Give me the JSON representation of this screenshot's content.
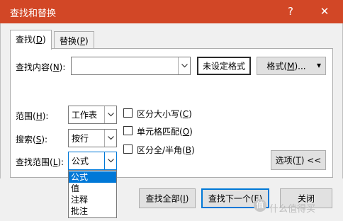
{
  "window": {
    "title": "查找和替换",
    "help_glyph": "?",
    "close_glyph": "✕"
  },
  "tabs": [
    {
      "text": "查找(",
      "key": "D",
      "tail": ")"
    },
    {
      "text": "替换(",
      "key": "P",
      "tail": ")"
    }
  ],
  "find": {
    "label_text": "查找内容(",
    "label_key": "N",
    "label_tail": "):",
    "value": "",
    "no_format_label": "未设定格式",
    "format_btn_text": "格式(",
    "format_btn_key": "M",
    "format_btn_tail": ")...",
    "format_arrow": "▾"
  },
  "scope": {
    "label_text": "范围(",
    "label_key": "H",
    "label_tail": "):",
    "value": "工作表"
  },
  "search": {
    "label_text": "搜索(",
    "label_key": "S",
    "label_tail": "):",
    "value": "按行"
  },
  "lookin": {
    "label_text": "查找范围(",
    "label_key": "L",
    "label_tail": "):",
    "value": "公式",
    "options": [
      "公式",
      "值",
      "注释",
      "批注"
    ],
    "selected_index": 0
  },
  "checkboxes": [
    {
      "text": "区分大小写(",
      "key": "C",
      "tail": ")",
      "checked": false
    },
    {
      "text": "单元格匹配(",
      "key": "O",
      "tail": ")",
      "checked": false
    },
    {
      "text": "区分全/半角(",
      "key": "B",
      "tail": ")",
      "checked": false
    }
  ],
  "options_btn": {
    "text": "选项(",
    "key": "T",
    "tail": ") <<"
  },
  "bottom_buttons": {
    "find_all": {
      "text": "查找全部(",
      "key": "I",
      "tail": ")"
    },
    "find_next": {
      "text": "查找下一个(",
      "key": "F",
      "tail": ")"
    },
    "close": {
      "text": "关闭"
    }
  },
  "watermark": {
    "badge": "值",
    "text": "什么值得买"
  },
  "colors": {
    "title_bar": "#d24726",
    "selection": "#0078d7",
    "focus": "#0078d7"
  }
}
